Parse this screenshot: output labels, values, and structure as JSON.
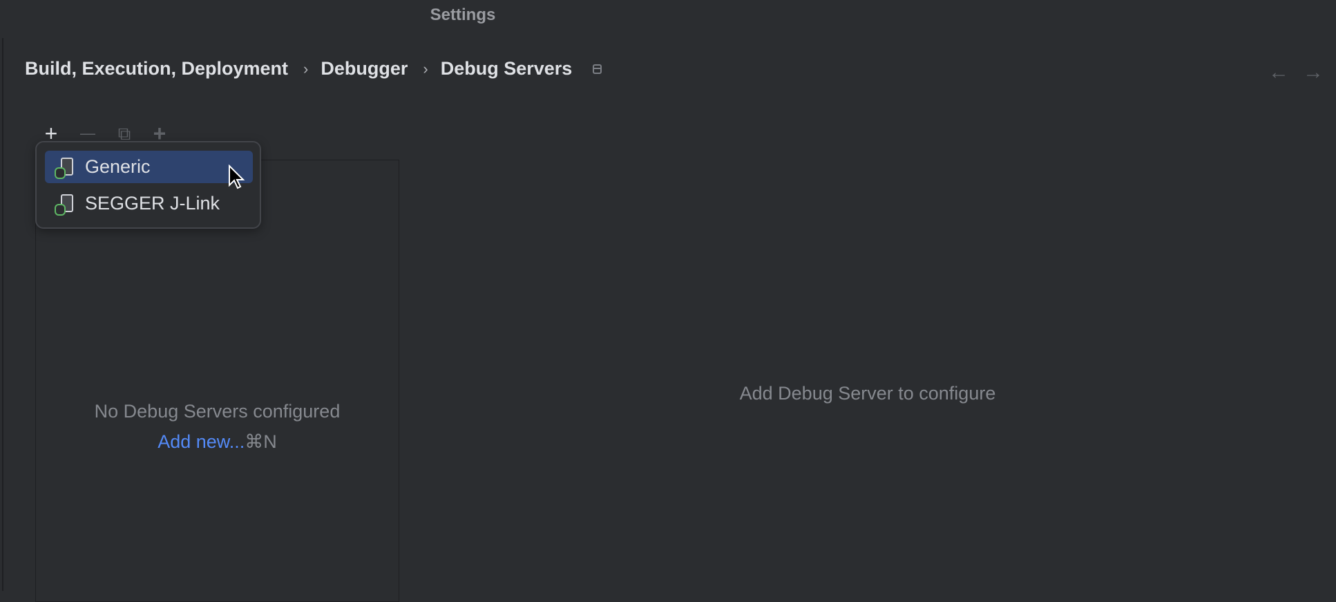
{
  "window": {
    "title": "Settings"
  },
  "breadcrumb": [
    "Build, Execution, Deployment",
    "Debugger",
    "Debug Servers"
  ],
  "breadcrumb_separator": "›",
  "nav": {
    "back": "←",
    "forward": "→"
  },
  "toolbar": {
    "add": "+",
    "remove": "—",
    "copy": "⧉",
    "add_special": "+"
  },
  "popup": {
    "items": [
      {
        "label": "Generic",
        "icon": "debug-server-icon",
        "selected": true
      },
      {
        "label": "SEGGER J-Link",
        "icon": "debug-server-icon",
        "selected": false
      }
    ]
  },
  "list": {
    "empty_text": "No Debug Servers configured",
    "add_link": "Add new...",
    "shortcut": "⌘N"
  },
  "detail": {
    "empty_text": "Add Debug Server to configure"
  },
  "colors": {
    "background": "#2b2d30",
    "selection": "#2e436e",
    "link": "#548af7"
  }
}
